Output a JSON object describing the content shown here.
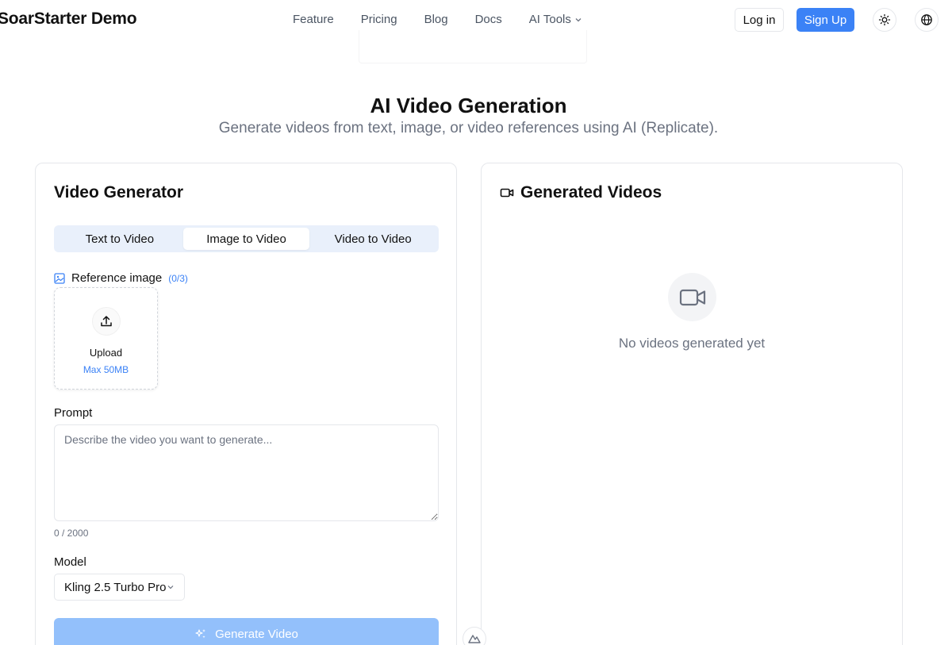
{
  "header": {
    "brand": "SoarStarter Demo",
    "nav": [
      {
        "label": "Feature"
      },
      {
        "label": "Pricing"
      },
      {
        "label": "Blog"
      },
      {
        "label": "Docs"
      },
      {
        "label": "AI Tools",
        "icon": "chevron-down-icon"
      }
    ],
    "login_label": "Log in",
    "signup_label": "Sign Up",
    "theme_icon": "sun-icon",
    "language_icon": "globe-icon"
  },
  "hero": {
    "title": "AI Video Generation",
    "subtitle": "Generate videos from text, image, or video references using AI (Replicate)."
  },
  "generator": {
    "title": "Video Generator",
    "tabs": [
      {
        "label": "Text to Video",
        "active": false
      },
      {
        "label": "Image to Video",
        "active": true
      },
      {
        "label": "Video to Video",
        "active": false
      }
    ],
    "reference": {
      "label": "Reference image",
      "count": "(0/3)",
      "upload_label": "Upload",
      "upload_max": "Max 50MB"
    },
    "prompt": {
      "label": "Prompt",
      "placeholder": "Describe the video you want to generate...",
      "value": "",
      "char_count": "0 / 2000"
    },
    "model": {
      "label": "Model",
      "selected": "Kling 2.5 Turbo Pro"
    },
    "generate_label": "Generate Video"
  },
  "results": {
    "title": "Generated Videos",
    "empty_text": "No videos generated yet"
  },
  "colors": {
    "accent": "#3b82f6",
    "accent_disabled": "#93c0fb",
    "tabs_bg": "#e9f0fb"
  }
}
